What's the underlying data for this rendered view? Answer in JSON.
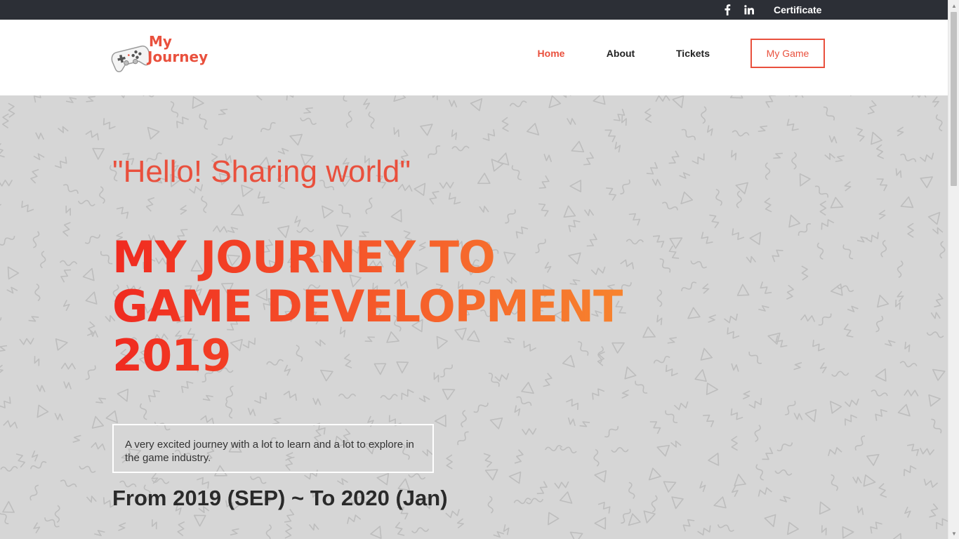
{
  "topbar": {
    "facebook_icon": "facebook-icon",
    "linkedin_icon": "linkedin-icon",
    "certificate_label": "Certificate"
  },
  "header": {
    "logo": {
      "line1": "My",
      "line2": "Journey",
      "icon": "gamepad-icon"
    },
    "nav": {
      "home": "Home",
      "about": "About",
      "tickets": "Tickets",
      "my_game": "My Game"
    }
  },
  "hero": {
    "greeting": "\"Hello! Sharing world\"",
    "headline_line1": "MY JOURNEY TO",
    "headline_line2": "GAME DEVELOPMENT",
    "headline_line3": "2019",
    "description": "A very excited journey with a lot to learn and a lot to explore in the game industry.",
    "dates": "From 2019 (SEP) ~ To 2020 (Jan)"
  },
  "colors": {
    "accent": "#e9503d",
    "topbar_bg": "#2c2f36",
    "hero_bg": "#d6d6d6",
    "headline_gradient_start": "#f02a20",
    "headline_gradient_end": "#f7872e"
  }
}
